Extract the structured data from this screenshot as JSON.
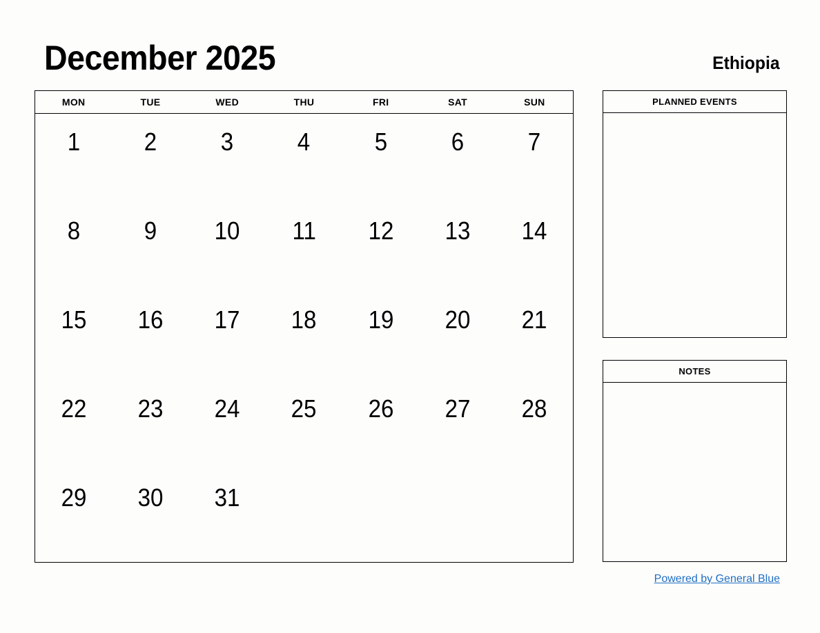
{
  "header": {
    "title": "December 2025",
    "region": "Ethiopia"
  },
  "calendar": {
    "weekdays": [
      "MON",
      "TUE",
      "WED",
      "THU",
      "FRI",
      "SAT",
      "SUN"
    ],
    "weeks": [
      [
        "1",
        "2",
        "3",
        "4",
        "5",
        "6",
        "7"
      ],
      [
        "8",
        "9",
        "10",
        "11",
        "12",
        "13",
        "14"
      ],
      [
        "15",
        "16",
        "17",
        "18",
        "19",
        "20",
        "21"
      ],
      [
        "22",
        "23",
        "24",
        "25",
        "26",
        "27",
        "28"
      ],
      [
        "29",
        "30",
        "31",
        "",
        "",
        "",
        ""
      ]
    ]
  },
  "panels": {
    "planned_events": {
      "title": "PLANNED EVENTS",
      "content": ""
    },
    "notes": {
      "title": "NOTES",
      "content": ""
    }
  },
  "footer": {
    "link_text": "Powered by General Blue",
    "link_color": "#1f6fc4"
  }
}
